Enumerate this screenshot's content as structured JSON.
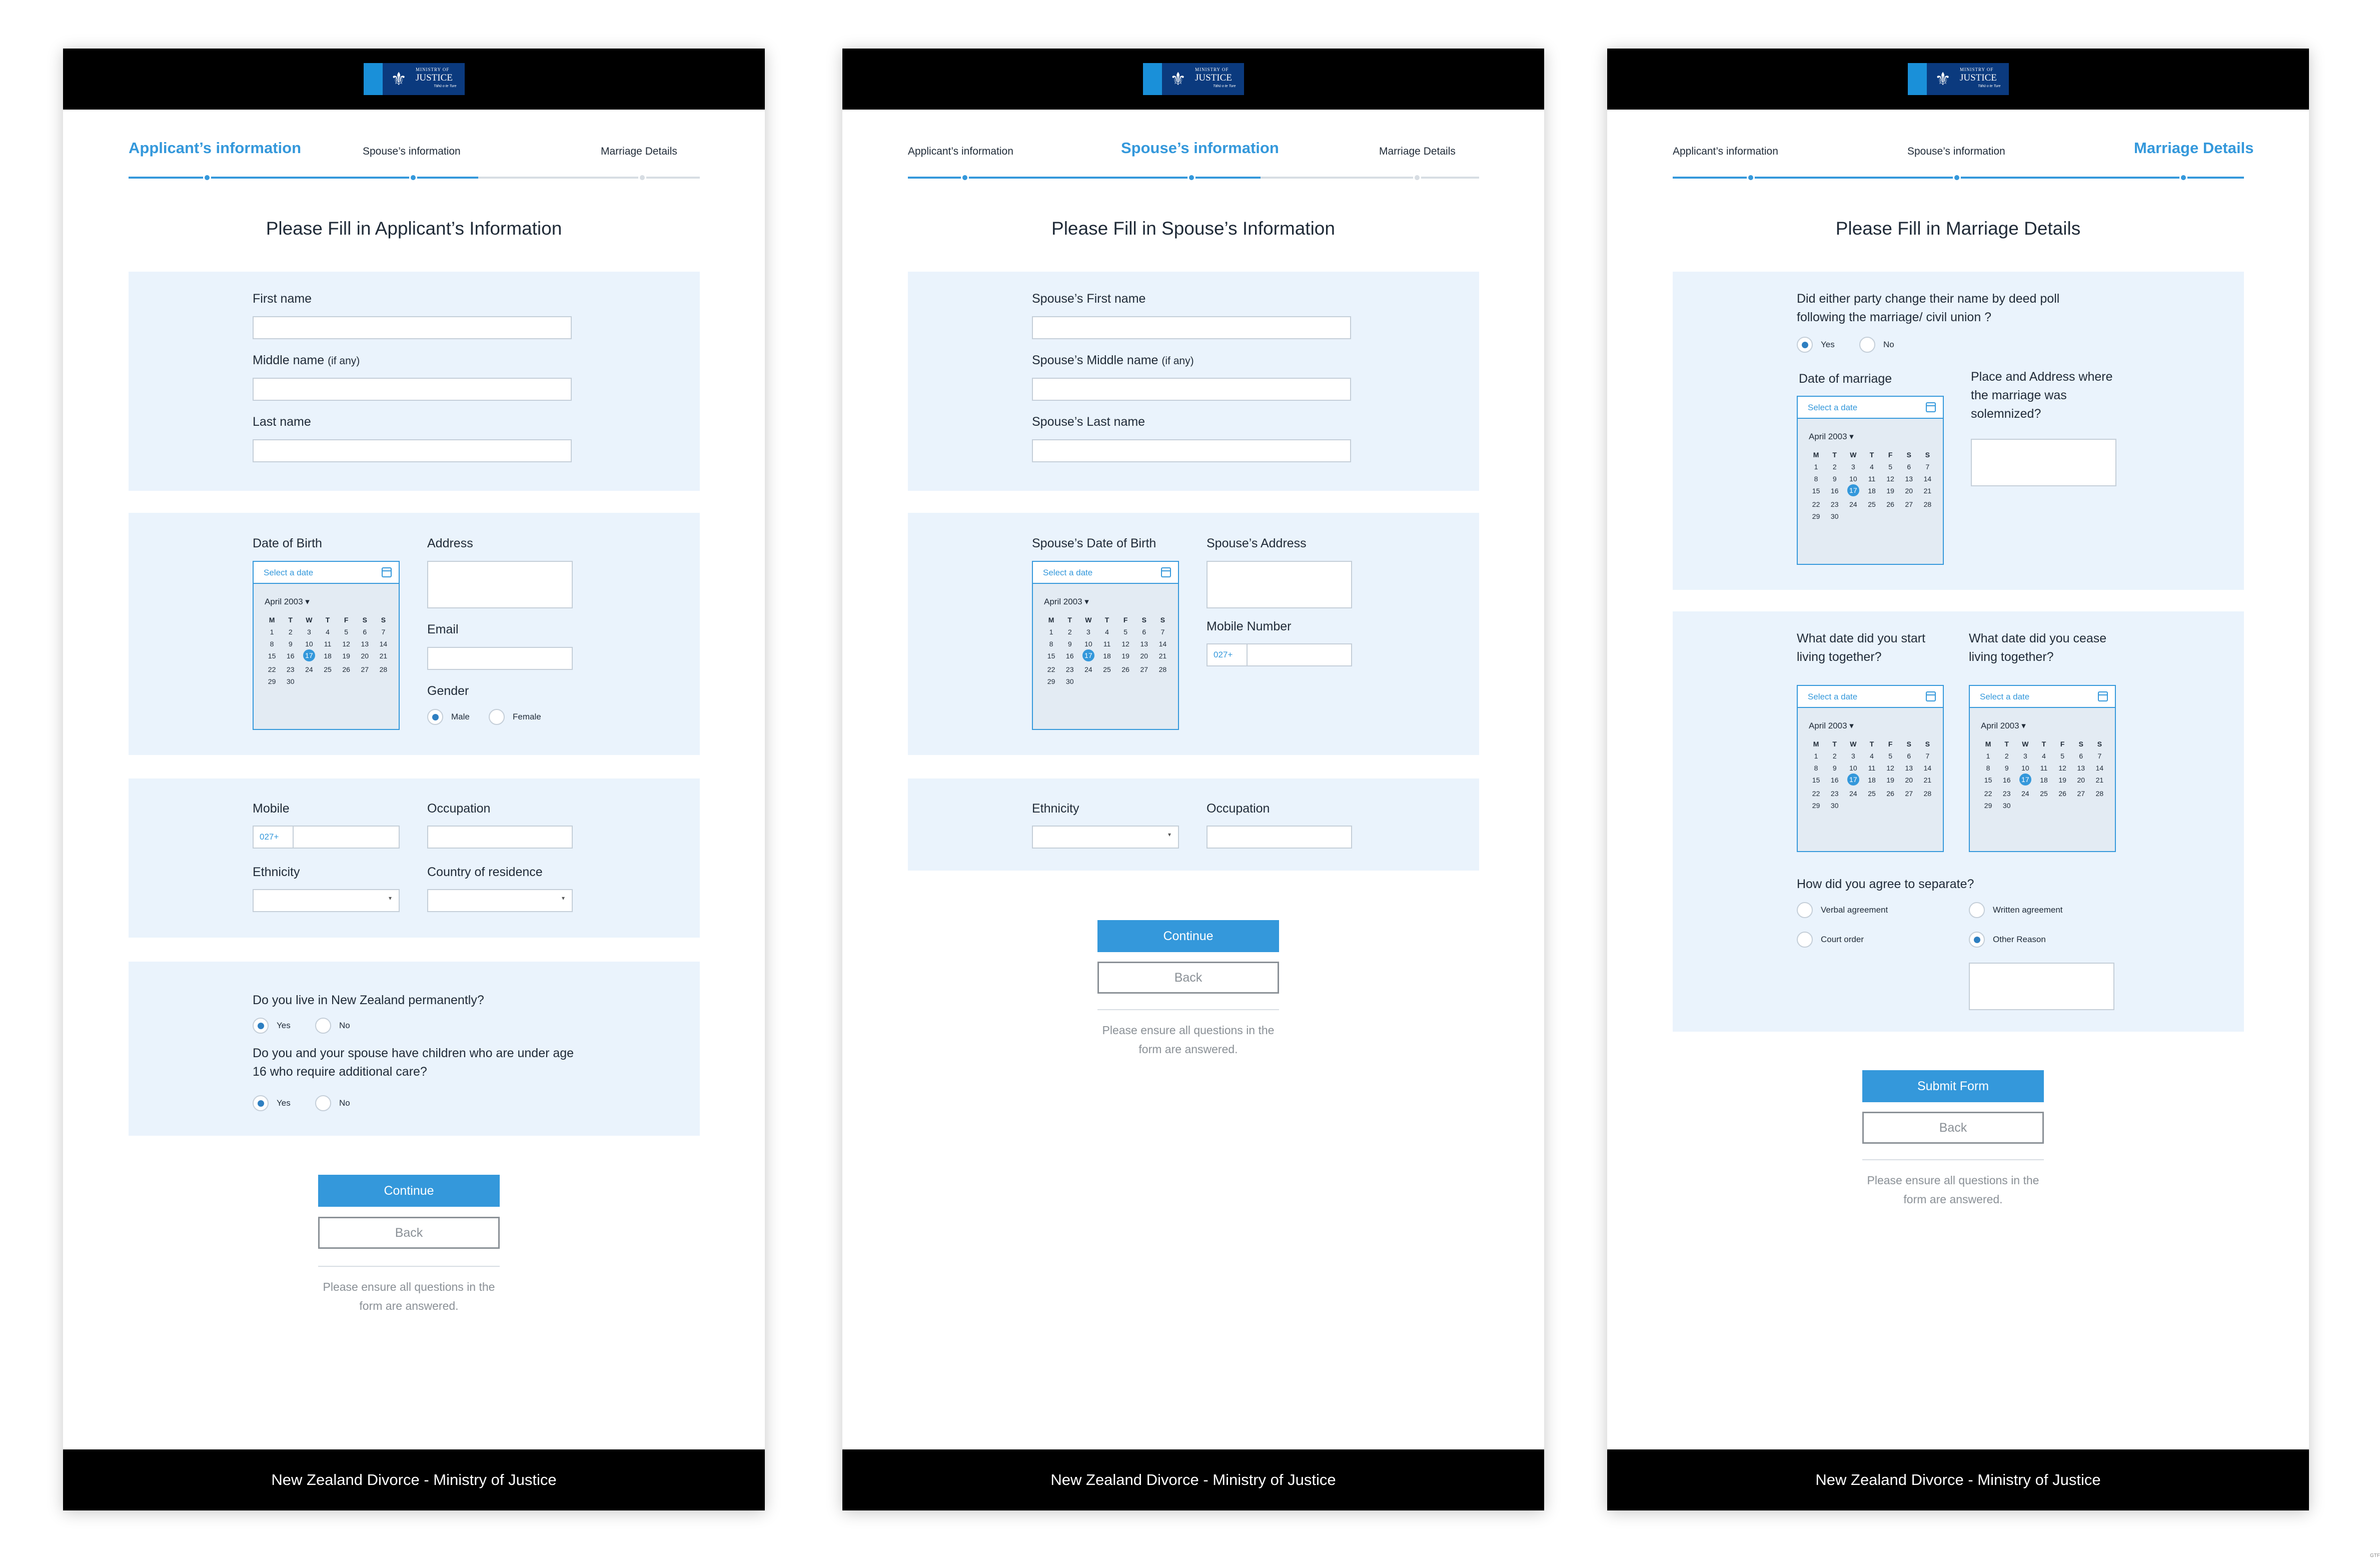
{
  "brand": {
    "ministry": "MINISTRY OF",
    "justice": "JUSTICE",
    "tagline": "Tāhū o te Ture",
    "crest": "⚜"
  },
  "footer_text": "New Zealand Divorce - Ministry of Justice",
  "steps": {
    "applicant": "Applicant’s information",
    "spouse": "Spouse’s information",
    "marriage": "Marriage Details"
  },
  "colors": {
    "accent": "#3498db",
    "panel": "#eaf3fc",
    "header": "#000000"
  },
  "calendar": {
    "placeholder": "Select a date",
    "month": "April 2003",
    "weekdays": [
      "M",
      "T",
      "W",
      "T",
      "F",
      "S",
      "S"
    ],
    "days": [
      "1",
      "2",
      "3",
      "4",
      "5",
      "6",
      "7",
      "8",
      "9",
      "10",
      "11",
      "12",
      "13",
      "14",
      "15",
      "16",
      "17",
      "18",
      "19",
      "20",
      "21",
      "22",
      "23",
      "24",
      "25",
      "26",
      "27",
      "28",
      "29",
      "30"
    ],
    "selected": "17"
  },
  "screen1": {
    "title": "Please Fill in Applicant’s Information",
    "first_name": "First name",
    "middle_name": "Middle name",
    "if_any": "(if any)",
    "last_name": "Last name",
    "dob": "Date of Birth",
    "address": "Address",
    "email": "Email",
    "gender": "Gender",
    "male": "Male",
    "female": "Female",
    "mobile": "Mobile",
    "mobile_prefix": "027+",
    "occupation": "Occupation",
    "ethnicity": "Ethnicity",
    "country": "Country of residence",
    "q_nz": "Do you live in New Zealand permanently?",
    "q_children": "Do you and your spouse have children who are under age 16 who require additional care?",
    "yes": "Yes",
    "no": "No",
    "continue": "Continue",
    "back": "Back",
    "note": "Please ensure all questions in the form are answered."
  },
  "screen2": {
    "title": "Please Fill in Spouse’s Information",
    "first_name": "Spouse’s First name",
    "middle_name": "Spouse’s Middle name",
    "if_any": "(if any)",
    "last_name": "Spouse’s Last name",
    "dob": "Spouse’s Date of Birth",
    "address": "Spouse’s Address",
    "mobile": "Mobile Number",
    "mobile_prefix": "027+",
    "ethnicity": "Ethnicity",
    "occupation": "Occupation",
    "continue": "Continue",
    "back": "Back",
    "note": "Please ensure all questions in the form are answered."
  },
  "screen3": {
    "title": "Please Fill in Marriage Details",
    "q_name_change": "Did either party change their name by deed poll following the marriage/ civil union ?",
    "yes": "Yes",
    "no": "No",
    "date_marriage": "Date of marriage",
    "place": "Place and Address where the marriage was solemnized?",
    "start_living": "What date did you start living together?",
    "cease_living": "What date did you cease living together?",
    "q_separate": "How did you agree to separate?",
    "verbal": "Verbal agreement",
    "written": "Written agreement",
    "court": "Court order",
    "other": "Other Reason",
    "submit": "Submit Form",
    "back": "Back",
    "note": "Please ensure all questions in the form are answered."
  },
  "credit": "GTF"
}
